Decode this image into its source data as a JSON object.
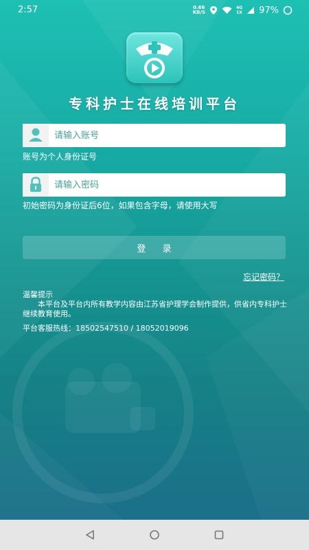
{
  "status_bar": {
    "time": "2:57",
    "net_speed_value": "0.66",
    "net_speed_unit": "KB/S",
    "network_top": "4G",
    "network_bottom": "1X",
    "battery_pct": "97%"
  },
  "app": {
    "title": "专科护士在线培训平台"
  },
  "login_form": {
    "account_placeholder": "请输入账号",
    "account_hint": "账号为个人身份证号",
    "password_placeholder": "请输入密码",
    "password_hint": "初始密码为身份证后6位，如果包含字母，请使用大写",
    "login_label": "登 录",
    "forgot_label": "忘记密码？"
  },
  "tips": {
    "heading": "温馨提示",
    "body": "本平台及平台内所有教学内容由江苏省护理学会制作提供，供省内专科护士继续教育使用。",
    "hotline": "平台客服热线：18502547510 / 18052019096"
  },
  "colors": {
    "bg_top": "#1ec0b4",
    "bg_bottom": "#1b6f8a",
    "input_icon": "#4fc3bb",
    "nav_bar": "#e6e6e6"
  }
}
